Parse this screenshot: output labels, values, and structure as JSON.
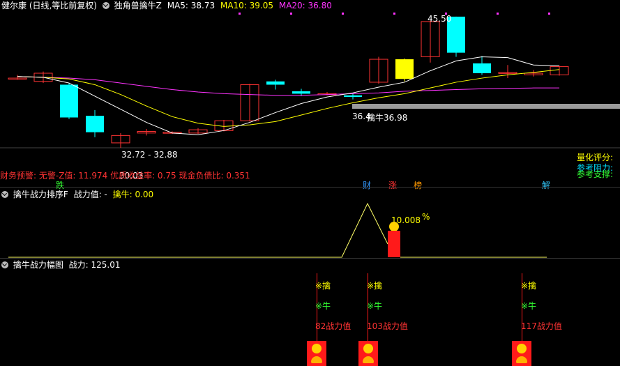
{
  "header": {
    "stock_title": "健尔康 (日线,等比前复权)",
    "indicator_name": "独角兽擒牛Z",
    "ma5": "MA5: 38.73",
    "ma10": "MA10: 39.05",
    "ma20": "MA20: 36.80",
    "colors": {
      "ma5": "#ffffff",
      "ma10": "#ffff00",
      "ma20": "#ff33ff"
    }
  },
  "main_chart": {
    "high_label": "45.50",
    "low_range_label": "32.72 - 32.88",
    "low_label": "30.03",
    "ref_label_1": "36.4",
    "ref_label_2": "擒牛36.98",
    "right_panel": {
      "score_label": "量化评分:",
      "resistance_label": "参考阻力:",
      "support_label": "参考支撑:"
    },
    "finance_line": "财务预警: 无警-Z值: 11.974 优质收益率: 0.75 现金负债比: 0.351",
    "tag_down": "跌",
    "tag_cai": "财",
    "tag_zhang": "涨",
    "tag_bang": "榜",
    "tag_jie": "解"
  },
  "panel2": {
    "title": "擒牛战力排序F",
    "value_label": "战力值: -",
    "qinniu_label": "擒牛: 0.00",
    "peak_value": "10.008",
    "percent": "%"
  },
  "panel3": {
    "title": "擒牛战力幅图",
    "power_label": "战力: 125.01",
    "signals": [
      {
        "qin": "※擒",
        "niu": "※牛",
        "power": "82战力值"
      },
      {
        "qin": "※擒",
        "niu": "※牛",
        "power": "103战力值"
      },
      {
        "qin": "※擒",
        "niu": "※牛",
        "power": "117战力值"
      }
    ]
  },
  "chart_data": {
    "type": "candlestick",
    "candles": [
      {
        "o": 38.0,
        "c": 38.0,
        "h": 38.4,
        "l": 37.8,
        "dir": "flat"
      },
      {
        "o": 37.6,
        "c": 38.6,
        "h": 38.8,
        "l": 37.4,
        "dir": "up"
      },
      {
        "o": 37.2,
        "c": 33.2,
        "h": 37.4,
        "l": 33.0,
        "dir": "down"
      },
      {
        "o": 33.4,
        "c": 31.4,
        "h": 34.1,
        "l": 30.8,
        "dir": "down"
      },
      {
        "o": 30.1,
        "c": 31.0,
        "h": 31.3,
        "l": 29.5,
        "dir": "up"
      },
      {
        "o": 31.3,
        "c": 31.5,
        "h": 31.8,
        "l": 31.0,
        "dir": "up"
      },
      {
        "o": 31.3,
        "c": 31.4,
        "h": 31.5,
        "l": 31.2,
        "dir": "flat"
      },
      {
        "o": 31.3,
        "c": 31.7,
        "h": 31.9,
        "l": 31.2,
        "dir": "up"
      },
      {
        "o": 31.6,
        "c": 32.8,
        "h": 32.9,
        "l": 31.5,
        "dir": "up"
      },
      {
        "o": 32.8,
        "c": 37.2,
        "h": 37.3,
        "l": 32.7,
        "dir": "up"
      },
      {
        "o": 37.6,
        "c": 37.2,
        "h": 37.8,
        "l": 36.6,
        "dir": "down"
      },
      {
        "o": 36.4,
        "c": 36.1,
        "h": 36.7,
        "l": 35.8,
        "dir": "down"
      },
      {
        "o": 36.1,
        "c": 36.1,
        "h": 36.3,
        "l": 35.9,
        "dir": "flat"
      },
      {
        "o": 35.9,
        "c": 35.7,
        "h": 36.2,
        "l": 35.4,
        "dir": "down"
      },
      {
        "o": 37.5,
        "c": 40.3,
        "h": 40.6,
        "l": 37.3,
        "dir": "up"
      },
      {
        "o": 40.3,
        "c": 37.9,
        "h": 40.4,
        "l": 37.6,
        "dir": "yellow"
      },
      {
        "o": 40.6,
        "c": 44.9,
        "h": 45.0,
        "l": 39.9,
        "dir": "up"
      },
      {
        "o": 45.5,
        "c": 41.1,
        "h": 45.5,
        "l": 40.6,
        "dir": "down"
      },
      {
        "o": 39.8,
        "c": 38.6,
        "h": 40.7,
        "l": 38.4,
        "dir": "down"
      },
      {
        "o": 38.6,
        "c": 38.7,
        "h": 39.6,
        "l": 38.0,
        "dir": "flat"
      },
      {
        "o": 38.4,
        "c": 38.6,
        "h": 39.0,
        "l": 38.2,
        "dir": "up"
      },
      {
        "o": 38.4,
        "c": 39.4,
        "h": 39.5,
        "l": 38.3,
        "dir": "up"
      }
    ],
    "ma5": [
      38.2,
      38.1,
      37.4,
      35.8,
      34.2,
      32.6,
      31.3,
      31.1,
      31.6,
      32.6,
      33.8,
      34.9,
      35.7,
      36.2,
      36.9,
      37.5,
      38.9,
      40.1,
      40.6,
      40.5,
      39.6,
      39.5
    ],
    "ma10": [
      38.2,
      38.1,
      37.9,
      37.2,
      36.0,
      34.6,
      33.3,
      32.5,
      32.1,
      32.3,
      32.7,
      33.5,
      34.3,
      35.0,
      35.6,
      36.1,
      36.8,
      37.5,
      38.0,
      38.4,
      38.7,
      39.05
    ],
    "ma20": [
      38.2,
      38.1,
      38.0,
      37.8,
      37.4,
      37.0,
      36.6,
      36.3,
      36.1,
      36.0,
      35.9,
      35.9,
      36.0,
      36.1,
      36.2,
      36.4,
      36.5,
      36.6,
      36.7,
      36.75,
      36.8,
      36.8
    ]
  }
}
